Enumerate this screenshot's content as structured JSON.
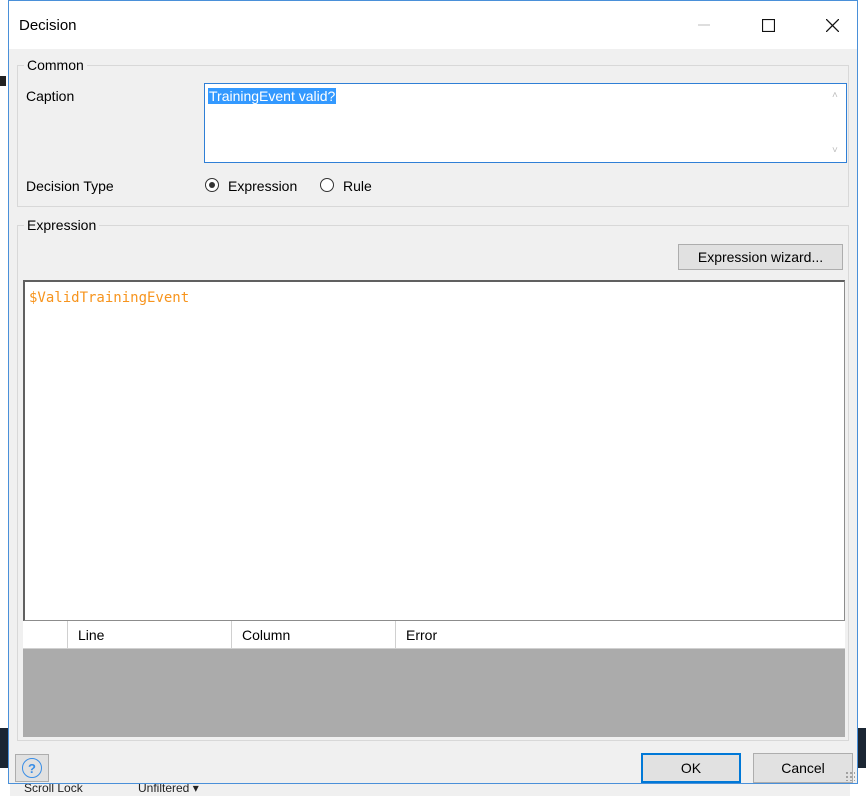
{
  "dialog": {
    "title": "Decision",
    "minimize_icon": "minimize-icon",
    "maximize_icon": "maximize-icon",
    "close_icon": "close-icon"
  },
  "common": {
    "legend": "Common",
    "caption_label": "Caption",
    "caption_value": "TrainingEvent valid?",
    "decision_type_label": "Decision Type",
    "options": [
      {
        "label": "Expression",
        "selected": true
      },
      {
        "label": "Rule",
        "selected": false
      }
    ]
  },
  "expression": {
    "legend": "Expression",
    "wizard_button": "Expression wizard...",
    "code": "$ValidTrainingEvent",
    "code_color": "#f7941d",
    "error_columns": [
      "",
      "Line",
      "Column",
      "Error"
    ]
  },
  "footer": {
    "help_icon": "help-icon",
    "help_glyph": "?",
    "ok_label": "OK",
    "cancel_label": "Cancel"
  },
  "background": {
    "status_left": "Scroll Lock",
    "status_right": "Unfiltered ▾"
  },
  "colors": {
    "accent": "#0078d7",
    "selection": "#3399ff",
    "error_pane": "#ababab"
  }
}
